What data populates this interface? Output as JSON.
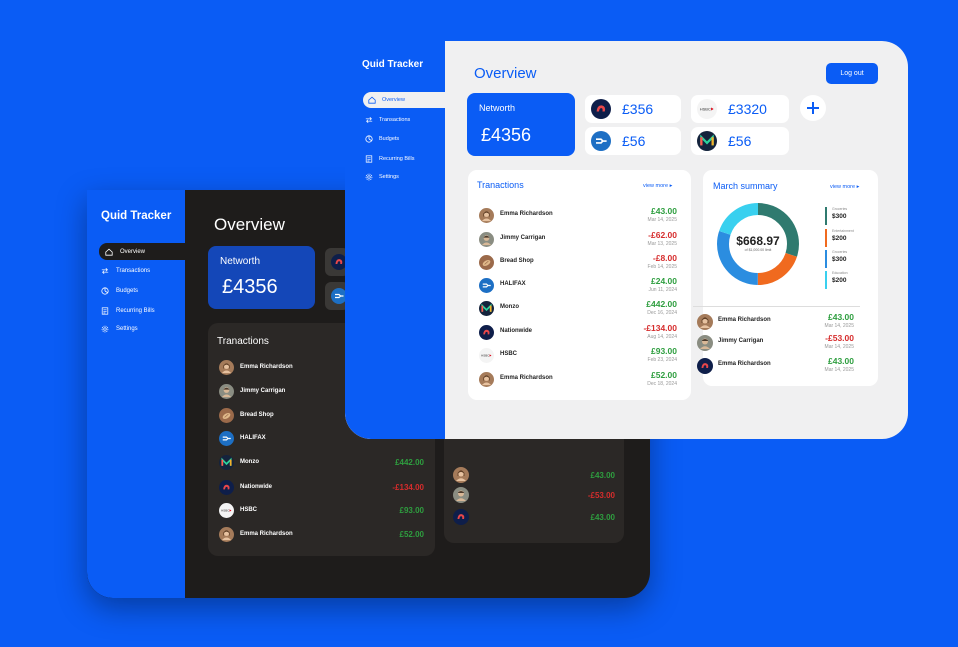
{
  "dark": {
    "brand": "Quid Tracker",
    "nav": [
      "Overview",
      "Transactions",
      "Budgets",
      "Recurring Bills",
      "Settings"
    ],
    "title": "Overview",
    "networth_label": "Networth",
    "networth_value": "£4356",
    "tx_title": "Tranactions",
    "tx": [
      {
        "name": "Emma Richardson",
        "amount": ""
      },
      {
        "name": "Jimmy Carrigan",
        "amount": ""
      },
      {
        "name": "Bread Shop",
        "amount": ""
      },
      {
        "name": "HALIFAX",
        "amount": ""
      },
      {
        "name": "Monzo",
        "amount": "£442.00"
      },
      {
        "name": "Nationwide",
        "amount": "-£134.00"
      },
      {
        "name": "HSBC",
        "amount": "£93.00"
      },
      {
        "name": "Emma Richardson",
        "amount": "£52.00"
      }
    ],
    "summary_amounts": [
      "£43.00",
      "-£53.00",
      "£43.00"
    ]
  },
  "light": {
    "brand": "Quid Tracker",
    "nav": [
      "Overview",
      "Transactions",
      "Budgets",
      "Recurring Bills",
      "Settings"
    ],
    "title": "Overview",
    "logout": "Log out",
    "networth_label": "Networth",
    "networth_value": "£4356",
    "accounts": [
      {
        "icon": "nationwide-icon",
        "amount": "£356"
      },
      {
        "icon": "hsbc-icon",
        "amount": "£3320"
      },
      {
        "icon": "halifax-icon",
        "amount": "£56"
      },
      {
        "icon": "monzo-icon",
        "amount": "£56"
      }
    ],
    "tx_title": "Tranactions",
    "view_more": "view more ▸",
    "tx": [
      {
        "name": "Emma Richardson",
        "amount": "£43.00",
        "date": "Mar 14, 2025"
      },
      {
        "name": "Jimmy Carrigan",
        "amount": "-£62.00",
        "date": "Mar 13, 2025"
      },
      {
        "name": "Bread Shop",
        "amount": "-£8.00",
        "date": "Feb 14, 2025"
      },
      {
        "name": "HALIFAX",
        "amount": "£24.00",
        "date": "Jun 11, 2024"
      },
      {
        "name": "Monzo",
        "amount": "£442.00",
        "date": "Dec 16, 2024"
      },
      {
        "name": "Nationwide",
        "amount": "-£134.00",
        "date": "Aug 14, 2024"
      },
      {
        "name": "HSBC",
        "amount": "£93.00",
        "date": "Feb 23, 2024"
      },
      {
        "name": "Emma Richardson",
        "amount": "£52.00",
        "date": "Dec 18, 2024"
      }
    ],
    "summary_title": "March summary",
    "summary_total": "$668.97",
    "summary_sub": "of $1,000.00 limit",
    "legend": [
      {
        "label": "Groceries",
        "value": "$300",
        "color": "#2f7a6f"
      },
      {
        "label": "Entertainment",
        "value": "$200",
        "color": "#f06a1f"
      },
      {
        "label": "Groceries",
        "value": "$300",
        "color": "#2b8de0"
      },
      {
        "label": "Education",
        "value": "$200",
        "color": "#39d0ef"
      }
    ],
    "summary_tx": [
      {
        "name": "Emma Richardson",
        "amount": "£43.00",
        "date": "Mar 14, 2025"
      },
      {
        "name": "Jimmy Carrigan",
        "amount": "-£53.00",
        "date": "Mar 14, 2025"
      },
      {
        "name": "Emma Richardson",
        "amount": "£43.00",
        "date": "Mar 14, 2025"
      }
    ]
  }
}
